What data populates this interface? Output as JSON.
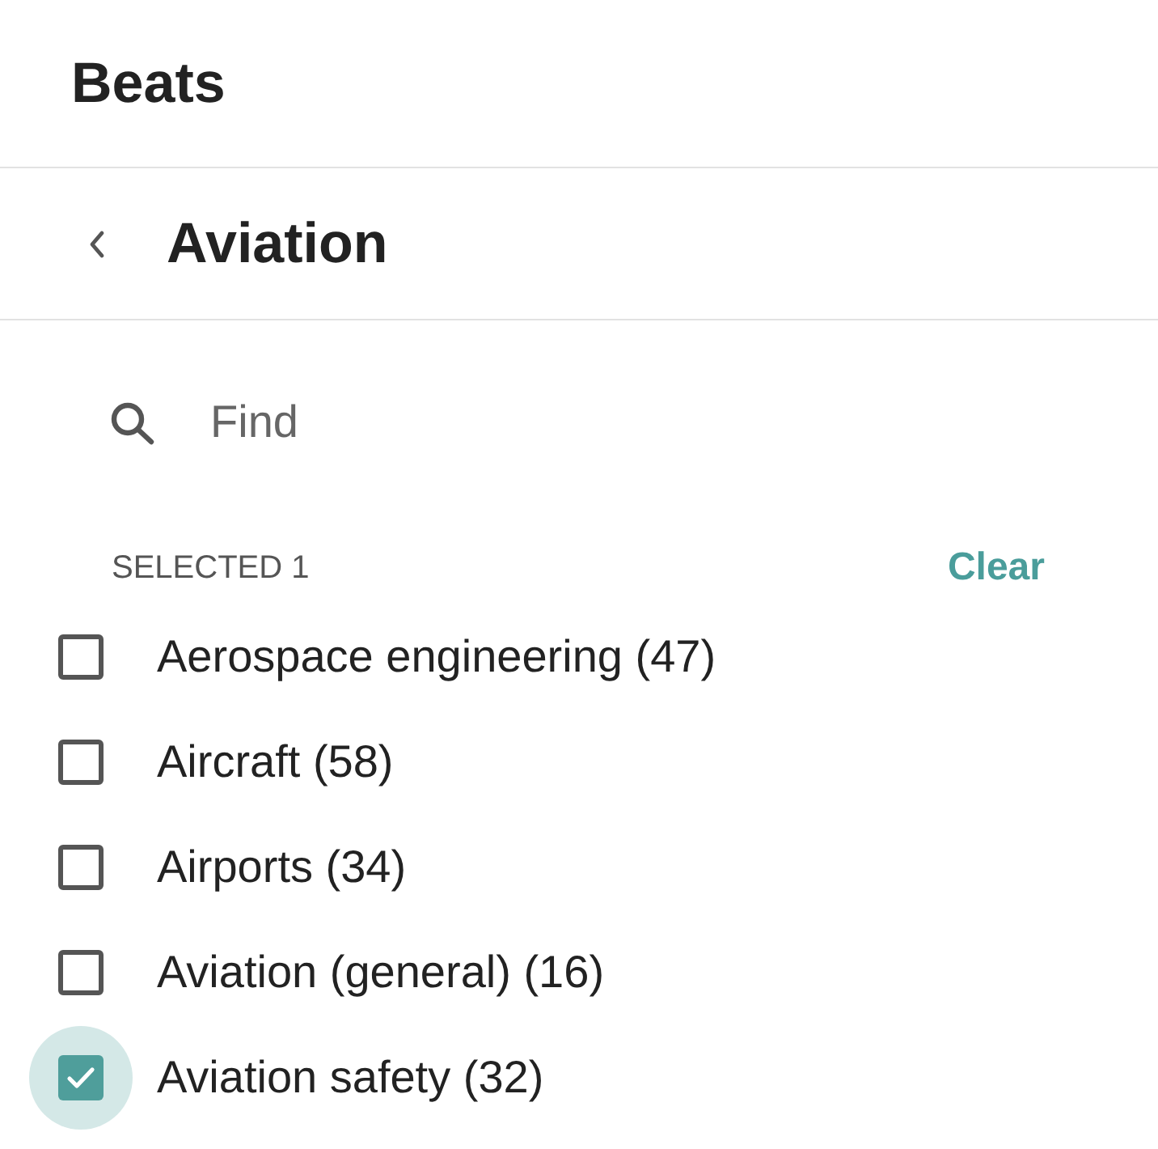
{
  "header": {
    "title": "Beats"
  },
  "subheader": {
    "title": "Aviation"
  },
  "search": {
    "placeholder": "Find"
  },
  "selection": {
    "label": "SELECTED 1",
    "clear_label": "Clear"
  },
  "items": [
    {
      "label": "Aerospace engineering (47)",
      "checked": false,
      "focused": false
    },
    {
      "label": "Aircraft (58)",
      "checked": false,
      "focused": false
    },
    {
      "label": "Airports (34)",
      "checked": false,
      "focused": false
    },
    {
      "label": "Aviation (general) (16)",
      "checked": false,
      "focused": false
    },
    {
      "label": "Aviation safety (32)",
      "checked": true,
      "focused": true
    }
  ]
}
